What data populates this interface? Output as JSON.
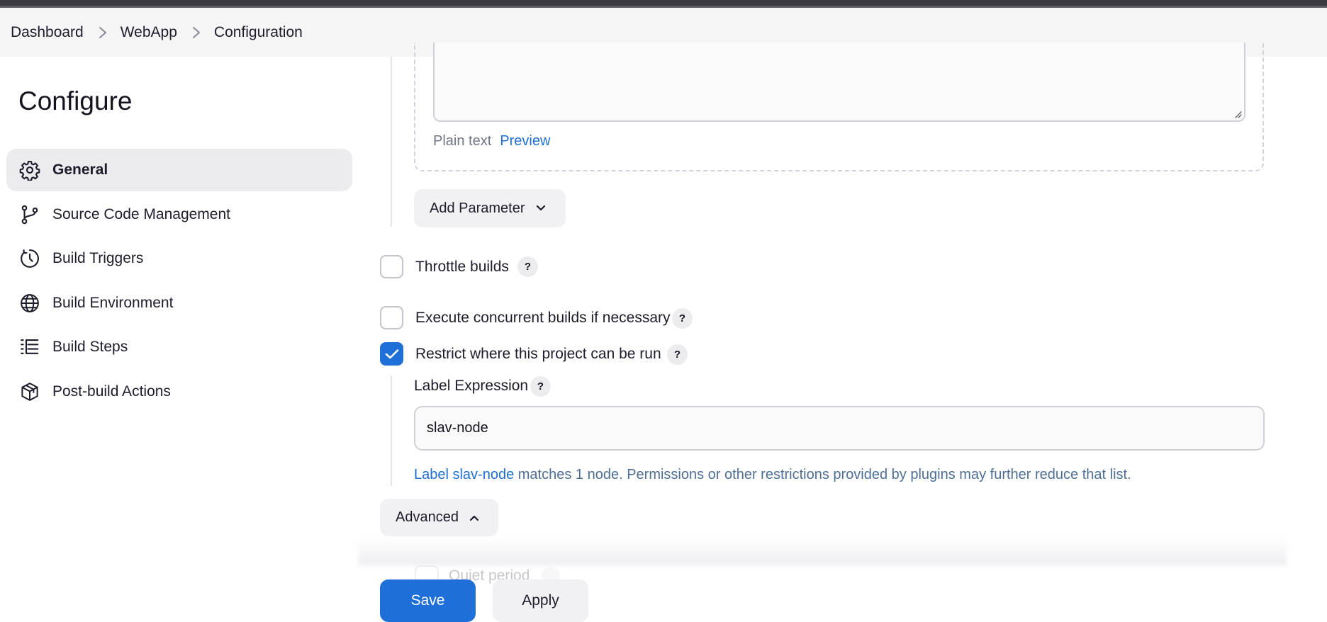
{
  "breadcrumb": {
    "items": [
      {
        "label": "Dashboard"
      },
      {
        "label": "WebApp"
      },
      {
        "label": "Configuration"
      }
    ]
  },
  "page": {
    "title": "Configure"
  },
  "sidebar": {
    "items": [
      {
        "label": "General",
        "icon": "gear-icon",
        "active": true
      },
      {
        "label": "Source Code Management",
        "icon": "branch-icon"
      },
      {
        "label": "Build Triggers",
        "icon": "clock-icon"
      },
      {
        "label": "Build Environment",
        "icon": "globe-icon"
      },
      {
        "label": "Build Steps",
        "icon": "list-icon"
      },
      {
        "label": "Post-build Actions",
        "icon": "package-icon"
      }
    ]
  },
  "description": {
    "mode_plain": "Plain text",
    "mode_preview": "Preview"
  },
  "parameters": {
    "add_label": "Add Parameter"
  },
  "options": {
    "throttle": {
      "label": "Throttle builds",
      "checked": false
    },
    "concurrent": {
      "label": "Execute concurrent builds if necessary",
      "checked": false
    },
    "restrict": {
      "label": "Restrict where this project can be run",
      "checked": true
    },
    "help_glyph": "?"
  },
  "label_expression": {
    "label": "Label Expression",
    "value": "slav-node",
    "match_link": "Label slav-node",
    "match_text": " matches 1 node. Permissions or other restrictions provided by plugins may further reduce that list."
  },
  "advanced": {
    "label": "Advanced"
  },
  "faded": {
    "label": "Quiet period"
  },
  "actions": {
    "save_label": "Save",
    "apply_label": "Apply"
  },
  "colors": {
    "accent": "#1f6fd8",
    "link": "#1f6fd0"
  }
}
